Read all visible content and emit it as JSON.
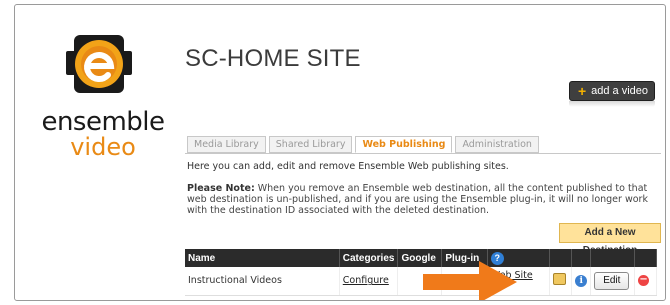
{
  "brand": {
    "word1": "ensemble",
    "word2": "video",
    "orange": "#e98a15",
    "dark": "#1a1a1a"
  },
  "header": {
    "site_title": "SC-HOME SITE",
    "add_video_label": "add a video"
  },
  "tabs": [
    {
      "label": "Media Library",
      "active": false
    },
    {
      "label": "Shared Library",
      "active": false
    },
    {
      "label": "Web Publishing",
      "active": true
    },
    {
      "label": "Administration",
      "active": false
    }
  ],
  "content": {
    "intro": "Here you can add, edit and remove Ensemble Web publishing sites.",
    "note_label": "Please Note:",
    "note_text": " When you remove an Ensemble web destination, all the content published to that web destination is un-published, and if you are using the Ensemble plug-in, it will no longer work with the destination ID associated with the deleted destination.",
    "add_destination_label": "Add a New Destination"
  },
  "table": {
    "headers": [
      "Name",
      "Categories",
      "Google",
      "Plug-in",
      "?"
    ],
    "rows": [
      {
        "name": "Instructional Videos",
        "categories_link": "Configure",
        "website_link": "Web Site",
        "edit_label": "Edit"
      }
    ]
  },
  "icons": {
    "add": "plus-icon",
    "help": "help-icon",
    "remove": "minus-circle-icon",
    "package": "package-icon",
    "info": "info-icon",
    "arrow": "orange-arrow-annotation"
  },
  "colors": {
    "accent": "#e98a15",
    "header_bg": "#2b2b2b",
    "add_dest_bg": "#ffe29a",
    "arrow": "#f07a1a"
  }
}
